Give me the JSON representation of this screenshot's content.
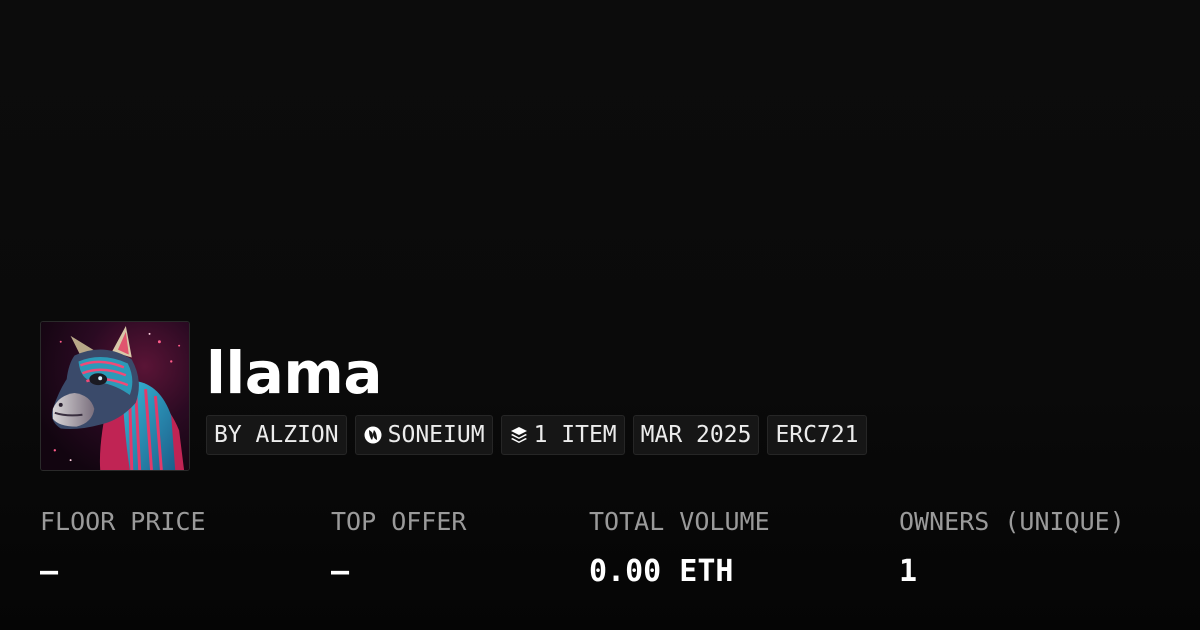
{
  "collection": {
    "title": "llama",
    "avatar_alt": "llama artwork"
  },
  "badges": {
    "creator": "BY ALZION",
    "chain": "SONEIUM",
    "chain_icon": "soneium-logo-icon",
    "items": "1 ITEM",
    "items_icon": "layers-icon",
    "date": "MAR 2025",
    "standard": "ERC721"
  },
  "stats": [
    {
      "label": "FLOOR PRICE",
      "value": "–"
    },
    {
      "label": "TOP OFFER",
      "value": "–"
    },
    {
      "label": "TOTAL VOLUME",
      "value": "0.00 ETH"
    },
    {
      "label": "OWNERS (UNIQUE)",
      "value": "1"
    }
  ],
  "colors": {
    "background": "#0a0a0a",
    "badge_background": "#161616",
    "label_gray": "#9a9a9a",
    "text": "#ffffff"
  }
}
